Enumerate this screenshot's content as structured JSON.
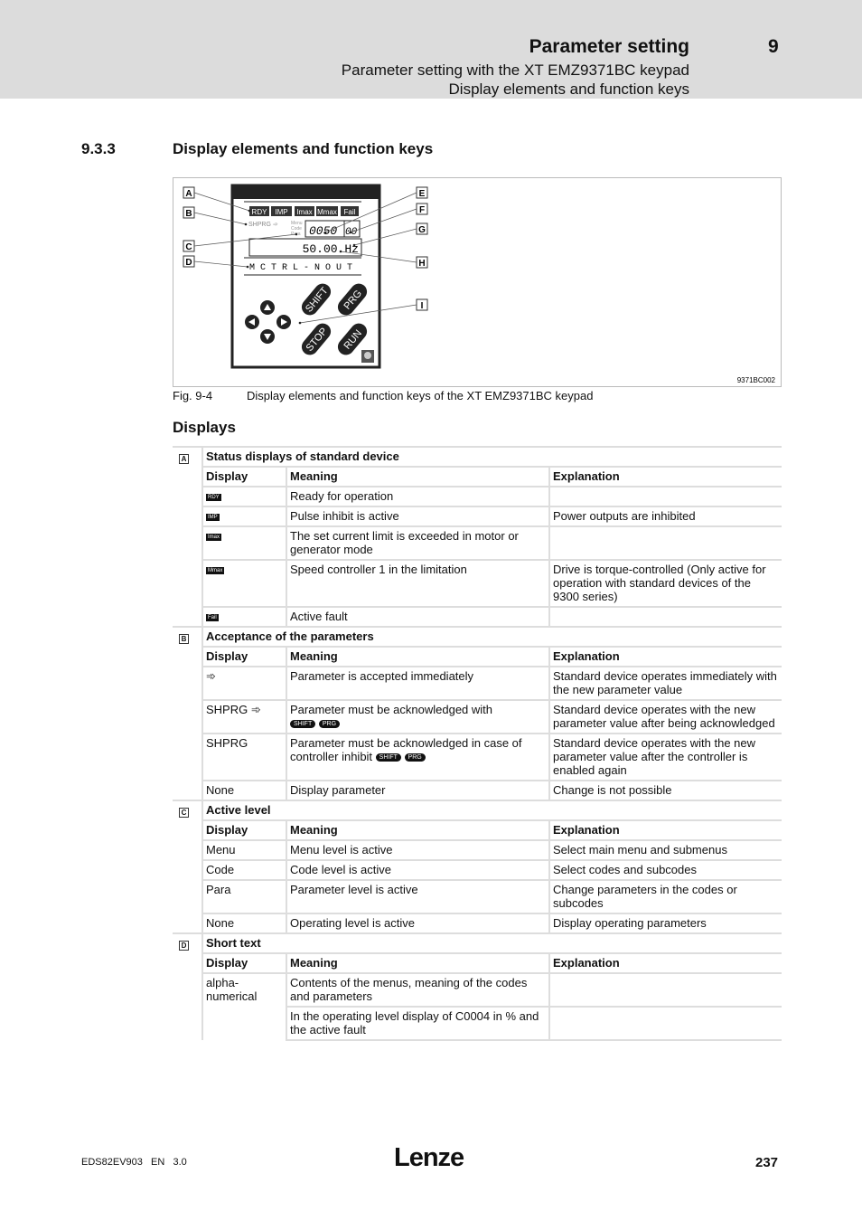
{
  "header": {
    "title": "Parameter setting",
    "chapter": "9",
    "subtitle1": "Parameter setting with the XT EMZ9371BC keypad",
    "subtitle2": "Display elements and function keys"
  },
  "section": {
    "number": "9.3.3",
    "title": "Display elements and function keys"
  },
  "figure": {
    "id": "9371BC002",
    "caption_label": "Fig. 9-4",
    "caption_text": "Display elements and function keys of the XT EMZ9371BC keypad",
    "callouts": [
      "A",
      "B",
      "C",
      "D",
      "E",
      "F",
      "G",
      "H",
      "I"
    ],
    "lcd": {
      "status": [
        "RDY",
        "IMP",
        "Imax",
        "Mmax",
        "Fail"
      ],
      "acceptance": "SHPRG ➾",
      "levels": [
        "Menu",
        "Code",
        "Para"
      ],
      "code": "0050",
      "subcode": "00",
      "value": "50.00 Hz",
      "short_text": "M C T R L - N O U T"
    },
    "keys": [
      "SHIFT",
      "PRG",
      "STOP",
      "RUN"
    ],
    "nav_icons": [
      "arrow-up",
      "arrow-down",
      "arrow-left",
      "arrow-right"
    ]
  },
  "displays_heading": "Displays",
  "columns": {
    "display": "Display",
    "meaning": "Meaning",
    "explanation": "Explanation"
  },
  "sections": [
    {
      "label": "A",
      "title": "Status displays of standard device",
      "rows": [
        {
          "display": "RDY",
          "display_type": "chip",
          "meaning": "Ready for operation",
          "explanation": ""
        },
        {
          "display": "IMP",
          "display_type": "chip",
          "meaning": "Pulse inhibit is active",
          "explanation": "Power outputs are inhibited"
        },
        {
          "display": "Imax",
          "display_type": "chip",
          "meaning": "The set current limit is exceeded in motor or generator mode",
          "explanation": ""
        },
        {
          "display": "Mmax",
          "display_type": "chip",
          "meaning": "Speed controller 1 in the limitation",
          "explanation": "Drive is torque-controlled (Only active for operation with standard devices of the 9300 series)"
        },
        {
          "display": "Fail",
          "display_type": "chip",
          "meaning": "Active fault",
          "explanation": ""
        }
      ]
    },
    {
      "label": "B",
      "title": "Acceptance of the parameters",
      "rows": [
        {
          "display": "➾",
          "meaning": "Parameter is accepted immediately",
          "explanation": "Standard device operates immediately with the new parameter value"
        },
        {
          "display": "SHPRG ➾",
          "meaning": "Parameter must be acknowledged with",
          "keys": [
            "SHIFT",
            "PRG"
          ],
          "explanation": "Standard device operates with the new parameter value after being acknowledged"
        },
        {
          "display": "SHPRG",
          "meaning": "Parameter must be acknowledged in case of controller inhibit",
          "keys": [
            "SHIFT",
            "PRG"
          ],
          "explanation": "Standard device operates with the new parameter value after the controller is enabled again"
        },
        {
          "display": "None",
          "meaning": "Display parameter",
          "explanation": "Change is not possible"
        }
      ]
    },
    {
      "label": "C",
      "title": "Active level",
      "rows": [
        {
          "display": "Menu",
          "meaning": "Menu level is active",
          "explanation": "Select main menu and submenus"
        },
        {
          "display": "Code",
          "meaning": "Code level is active",
          "explanation": "Select codes and subcodes"
        },
        {
          "display": "Para",
          "meaning": "Parameter level is active",
          "explanation": "Change parameters in the codes or subcodes"
        },
        {
          "display": "None",
          "meaning": "Operating level is active",
          "explanation": "Display operating parameters"
        }
      ]
    },
    {
      "label": "D",
      "title": "Short text",
      "rows": [
        {
          "display": "alpha-numerical",
          "meaning": "Contents of the menus, meaning of the codes and parameters",
          "explanation": ""
        },
        {
          "display": "",
          "meaning": "In the operating level display of C0004 in % and the active fault",
          "explanation": ""
        }
      ]
    }
  ],
  "footer": {
    "doc": "EDS82EV903   EN   3.0",
    "logo": "Lenze",
    "page": "237"
  }
}
